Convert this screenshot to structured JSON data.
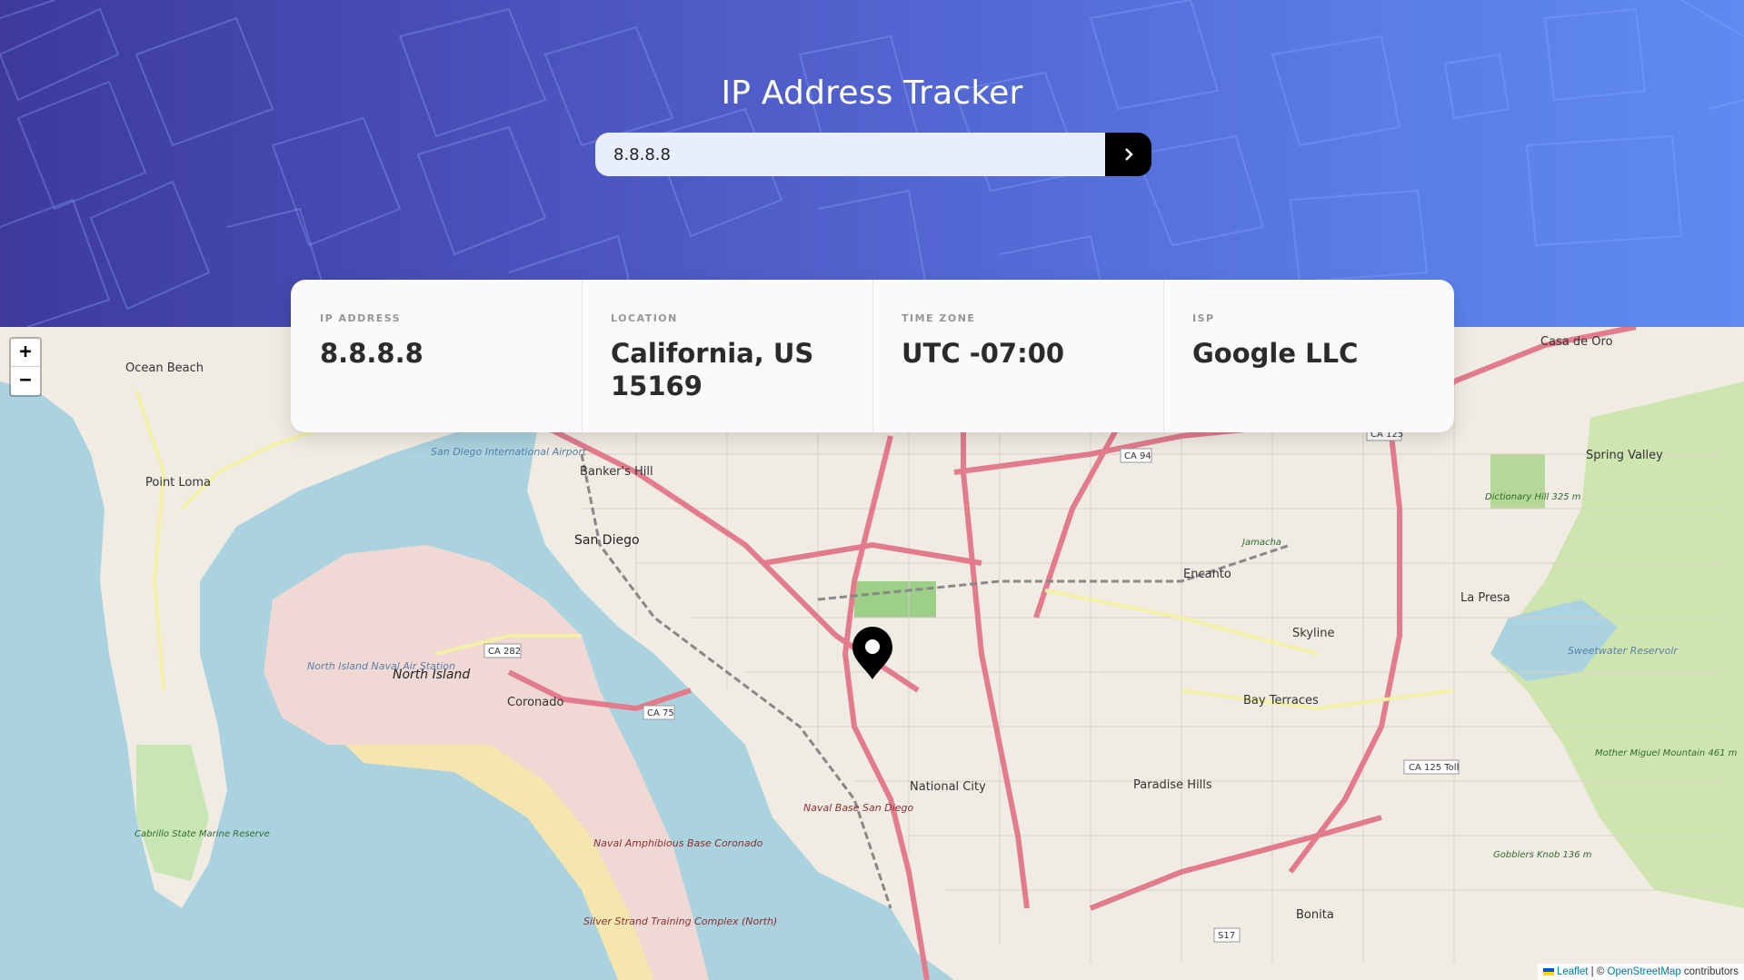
{
  "header": {
    "title": "IP Address Tracker",
    "search_value": "8.8.8.8",
    "submit_icon": "chevron-right-icon"
  },
  "info": {
    "ip_label": "IP ADDRESS",
    "ip_value": "8.8.8.8",
    "location_label": "LOCATION",
    "location_value": "California, US 15169",
    "timezone_label": "TIME ZONE",
    "timezone_value": "UTC -07:00",
    "isp_label": "ISP",
    "isp_value": "Google LLC"
  },
  "map": {
    "zoom_in": "+",
    "zoom_out": "−",
    "marker_icon": "location-pin-icon",
    "attribution": {
      "leaflet": "Leaflet",
      "separator": " | © ",
      "osm": "OpenStreetMap",
      "contributors": " contributors"
    },
    "places": [
      "Ocean Beach",
      "Point Loma",
      "San Diego",
      "Banker's Hill",
      "North Island",
      "Coronado",
      "National City",
      "Naval Base San Diego",
      "Paradise Hills",
      "Bay Terraces",
      "Skyline",
      "Encanto",
      "La Presa",
      "Spring Valley",
      "Casa de Oro",
      "Bonita",
      "Silver Strand Training Complex (North)",
      "Naval Amphibious Base Coronado",
      "Cabrillo State Marine Reserve",
      "North Island Naval Air Station",
      "San Diego International Airport",
      "Sweetwater Reservoir",
      "Dictionary Hill 325 m",
      "Mother Miguel Mountain 461 m",
      "Gobblers Knob 136 m",
      "Jamacha"
    ],
    "route_shields": [
      "CA 94",
      "CA 125",
      "CA 282",
      "CA 75",
      "CA 125 Toll",
      "S17"
    ]
  }
}
